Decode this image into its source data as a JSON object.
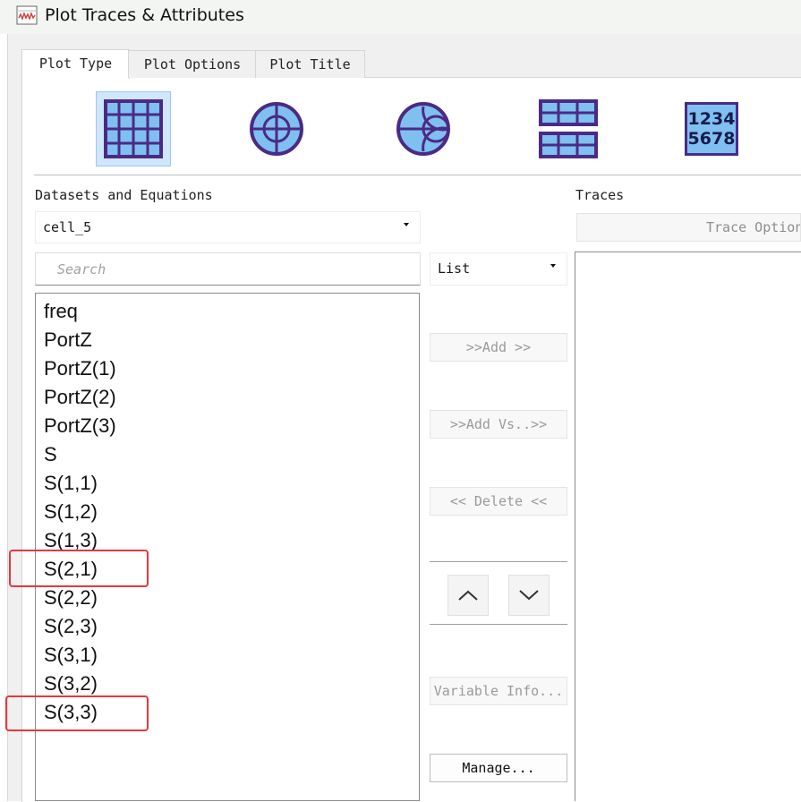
{
  "window": {
    "title": "Plot Traces & Attributes",
    "icon": "plot-window-icon"
  },
  "tabs": [
    {
      "label": "Plot Type",
      "active": true
    },
    {
      "label": "Plot Options",
      "active": false
    },
    {
      "label": "Plot Title",
      "active": false
    }
  ],
  "plot_types": [
    {
      "icon": "rectangular-plot-icon",
      "selected": true
    },
    {
      "icon": "polar-plot-icon",
      "selected": false
    },
    {
      "icon": "smith-chart-icon",
      "selected": false
    },
    {
      "icon": "stacked-plot-icon",
      "selected": false
    },
    {
      "icon": "list-view-icon",
      "text": "1234\n5678",
      "selected": false
    }
  ],
  "datasets": {
    "label": "Datasets and Equations",
    "selected": "cell_5",
    "search_placeholder": "Search",
    "view_mode": "List",
    "items": [
      "freq",
      "PortZ",
      "PortZ(1)",
      "PortZ(2)",
      "PortZ(3)",
      "S",
      "S(1,1)",
      "S(1,2)",
      "S(1,3)",
      "S(2,1)",
      "S(2,2)",
      "S(2,3)",
      "S(3,1)",
      "S(3,2)",
      "S(3,3)"
    ],
    "highlighted_items": [
      "S(2,1)",
      "S(3,3)"
    ]
  },
  "buttons": {
    "add": ">>Add >>",
    "add_vs": ">>Add Vs..>>",
    "delete": "<< Delete <<",
    "move_up": "move up",
    "move_down": "move down",
    "variable_info": "Variable Info...",
    "manage": "Manage..."
  },
  "traces": {
    "label": "Traces",
    "options_button": "Trace Options"
  },
  "colors": {
    "selection_bg": "#cfe6fb",
    "highlight_box": "#e8373e",
    "icon_purple": "#4b2a86",
    "icon_fill": "#6fb6ef"
  }
}
